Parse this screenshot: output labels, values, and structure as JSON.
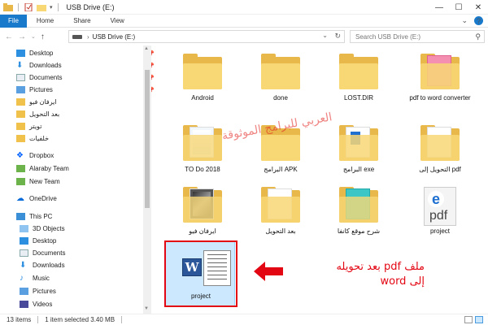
{
  "window": {
    "title": "USB Drive (E:)"
  },
  "ribbon": {
    "tabs": [
      "File",
      "Home",
      "Share",
      "View"
    ]
  },
  "address": {
    "path": "USB Drive (E:)",
    "search_placeholder": "Search USB Drive (E:)"
  },
  "sidebar": {
    "items": [
      {
        "label": "Desktop",
        "pinned": true
      },
      {
        "label": "Downloads",
        "pinned": true
      },
      {
        "label": "Documents",
        "pinned": true
      },
      {
        "label": "Pictures",
        "pinned": true
      },
      {
        "label": "ايرفان فيو",
        "pinned": false
      },
      {
        "label": "بعد التحويل",
        "pinned": false
      },
      {
        "label": "تويتر",
        "pinned": false
      },
      {
        "label": "خلفيات",
        "pinned": false
      },
      {
        "label": "Dropbox",
        "pinned": false
      },
      {
        "label": "Alaraby Team",
        "pinned": false
      },
      {
        "label": "New Team",
        "pinned": false
      },
      {
        "label": "OneDrive",
        "pinned": false
      },
      {
        "label": "This PC",
        "pinned": false
      },
      {
        "label": "3D Objects",
        "pinned": false
      },
      {
        "label": "Desktop",
        "pinned": false
      },
      {
        "label": "Documents",
        "pinned": false
      },
      {
        "label": "Downloads",
        "pinned": false
      },
      {
        "label": "Music",
        "pinned": false
      },
      {
        "label": "Pictures",
        "pinned": false
      },
      {
        "label": "Videos",
        "pinned": false
      }
    ]
  },
  "files": [
    {
      "label": "Android",
      "type": "folder"
    },
    {
      "label": "done",
      "type": "folder"
    },
    {
      "label": "LOST.DIR",
      "type": "folder"
    },
    {
      "label": "pdf to word converter",
      "type": "folder"
    },
    {
      "label": "TO Do 2018",
      "type": "folder"
    },
    {
      "label": "البرامج  APK",
      "type": "folder"
    },
    {
      "label": "البرامج  exe",
      "type": "folder"
    },
    {
      "label": "التحويل إلى pdf",
      "type": "folder"
    },
    {
      "label": "ايرفان فيو",
      "type": "folder"
    },
    {
      "label": "بعد التحويل",
      "type": "folder"
    },
    {
      "label": "شرح موقع كانفا",
      "type": "folder"
    },
    {
      "label": "project",
      "type": "pdf"
    },
    {
      "label": "project",
      "type": "docx",
      "selected": true
    }
  ],
  "watermark": "العربي للبرامج الموثوقة",
  "annotation": {
    "line1": "ملف pdf بعد تحويله",
    "line2": "إلى word"
  },
  "status": {
    "count": "13 items",
    "selection": "1 item selected  3.40 MB"
  },
  "colors": {
    "accent": "#1979ca",
    "annotation": "#e30613",
    "selection": "#cce8ff"
  }
}
